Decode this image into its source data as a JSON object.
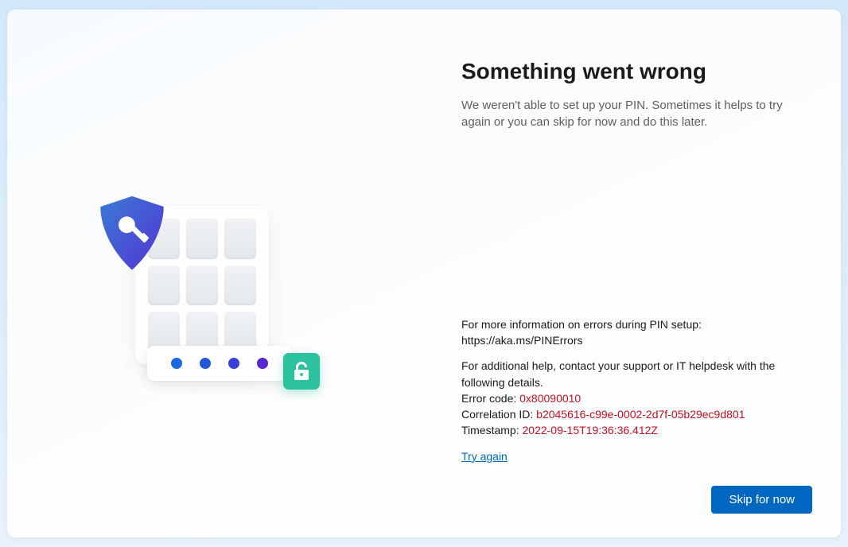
{
  "title": "Something went wrong",
  "subtitle": "We weren't able to set up your PIN. Sometimes it helps to try again or you can skip for now and do this later.",
  "info": {
    "more_info_label": "For more information on errors during PIN setup:",
    "more_info_url": "https://aka.ms/PINErrors",
    "help_text": "For additional help, contact your support or IT helpdesk with the following details.",
    "error_code_label": "Error code: ",
    "error_code": "0x80090010",
    "correlation_label": "Correlation ID: ",
    "correlation_id": "b2045616-c99e-0002-2d7f-05b29ec9d801",
    "timestamp_label": "Timestamp: ",
    "timestamp": "2022-09-15T19:36:36.412Z"
  },
  "actions": {
    "try_again": "Try again",
    "skip": "Skip for now"
  }
}
